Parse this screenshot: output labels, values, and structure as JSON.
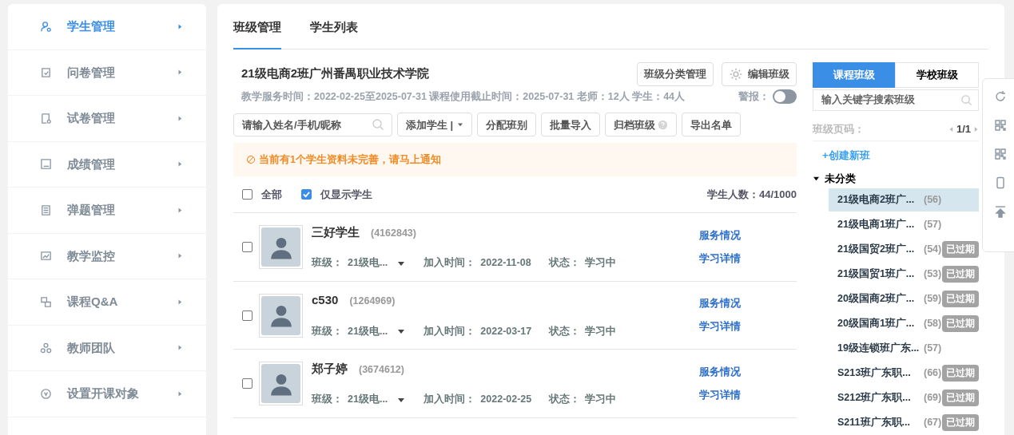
{
  "sidebar": {
    "items": [
      {
        "label": "学生管理",
        "selected": true
      },
      {
        "label": "问卷管理",
        "selected": false
      },
      {
        "label": "试卷管理",
        "selected": false
      },
      {
        "label": "成绩管理",
        "selected": false
      },
      {
        "label": "弹题管理",
        "selected": false
      },
      {
        "label": "教学监控",
        "selected": false
      },
      {
        "label": "课程Q&A",
        "selected": false
      },
      {
        "label": "教师团队",
        "selected": false
      },
      {
        "label": "设置开课对象",
        "selected": false
      }
    ]
  },
  "tabs": [
    {
      "label": "班级管理",
      "selected": true
    },
    {
      "label": "学生列表",
      "selected": false
    }
  ],
  "class_header": {
    "title": "21级电商2班广州番禺职业技术学院",
    "info": "教学服务时间：2022-02-25至2025-07-31 课程使用截止时间：2025-07-31 老师：12人 学生：44人",
    "buttons": [
      "班级分类管理",
      "编辑班级"
    ],
    "alert_label": "警报：",
    "alert_on": false
  },
  "search": {
    "placeholder": "请输入姓名/手机/昵称"
  },
  "actions": [
    {
      "label": "添加学生 |",
      "kind": "dropdown"
    },
    {
      "label": "分配班别",
      "kind": "plain"
    },
    {
      "label": "批量导入",
      "kind": "plain"
    },
    {
      "label": "归档班级",
      "kind": "help"
    },
    {
      "label": "导出名单",
      "kind": "plain"
    }
  ],
  "notice": "当前有1个学生资料未完善，请马上通知",
  "filters": [
    {
      "label": "全部",
      "checked": false
    },
    {
      "label": "仅显示学生",
      "checked": true
    }
  ],
  "student_count": "学生人数：44/1000",
  "students": [
    {
      "name": "三好学生",
      "id": "(4162843)",
      "class_label": "班级：",
      "class": "21级电...",
      "join_label": "加入时间：",
      "join": "2022-11-08",
      "status_label": "状态：",
      "status": "学习中",
      "links": [
        "服务情况",
        "学习详情"
      ],
      "checked": false
    },
    {
      "name": "c530",
      "id": "(1264969)",
      "class_label": "班级：",
      "class": "21级电...",
      "join_label": "加入时间：",
      "join": "2022-03-17",
      "status_label": "状态：",
      "status": "学习中",
      "links": [
        "服务情况",
        "学习详情"
      ],
      "checked": false
    },
    {
      "name": "郑子婷",
      "id": "(3674612)",
      "class_label": "班级：",
      "class": "21级电...",
      "join_label": "加入时间：",
      "join": "2022-02-25",
      "status_label": "状态：",
      "status": "学习中",
      "links": [
        "服务情况",
        "学习详情"
      ],
      "checked": false
    }
  ],
  "right_panel": {
    "tabs": [
      {
        "label": "课程班级",
        "selected": true
      },
      {
        "label": "学校班级",
        "selected": false
      }
    ],
    "search": {
      "placeholder": "输入关键字搜索班级"
    },
    "page_label": "班级页码：",
    "page": "1/1",
    "create": "+创建新班",
    "category": {
      "label": "未分类",
      "expanded": true,
      "classes": [
        {
          "name": "21级电商2班广...",
          "count": "(56)",
          "selected": true
        },
        {
          "name": "21级电商1班广...",
          "count": "(57)",
          "selected": false
        },
        {
          "name": "21级国贸2班广...",
          "count": "(54)",
          "badge": "已过期",
          "selected": false
        },
        {
          "name": "21级国贸1班广...",
          "count": "(53)",
          "badge": "已过期",
          "selected": false
        },
        {
          "name": "20级国商2班广...",
          "count": "(59)",
          "badge": "已过期",
          "selected": false
        },
        {
          "name": "20级国商1班广...",
          "count": "(58)",
          "badge": "已过期",
          "selected": false
        },
        {
          "name": "19级连锁班广东...",
          "count": "(57)",
          "selected": false
        },
        {
          "name": "S213班广东职...",
          "count": "(66)",
          "badge": "已过期",
          "selected": false
        },
        {
          "name": "S212班广东职...",
          "count": "(69)",
          "badge": "已过期",
          "selected": false
        },
        {
          "name": "S211班广东职...",
          "count": "(67)",
          "badge": "已过期",
          "selected": false
        }
      ]
    }
  }
}
